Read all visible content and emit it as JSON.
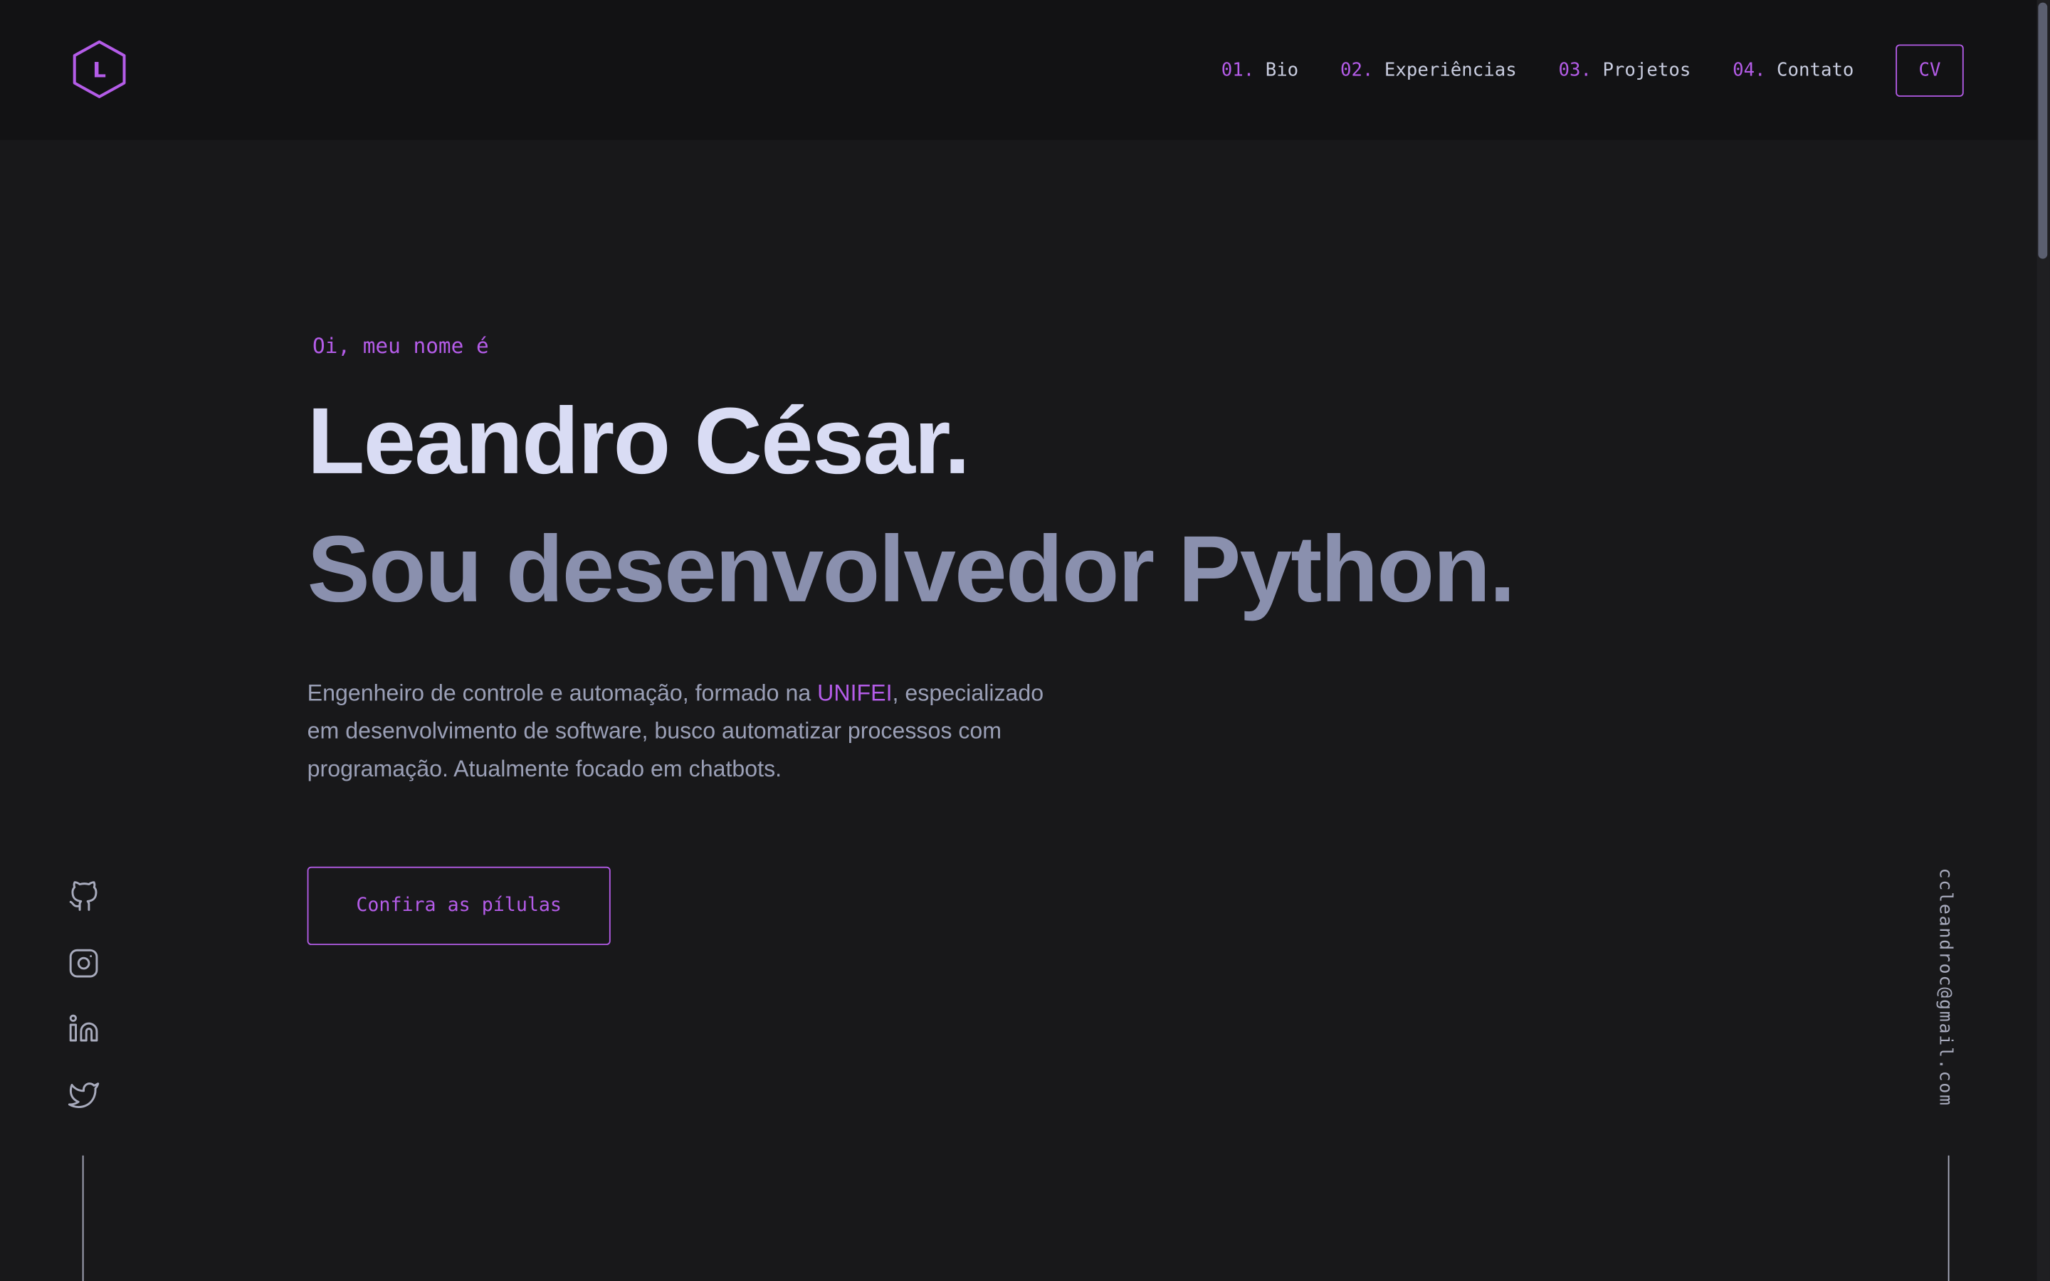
{
  "brand": {
    "logo_letter": "L",
    "accent_color": "#b45ce8"
  },
  "nav": {
    "items": [
      {
        "num": "01.",
        "label": "Bio"
      },
      {
        "num": "02.",
        "label": "Experiências"
      },
      {
        "num": "03.",
        "label": "Projetos"
      },
      {
        "num": "04.",
        "label": "Contato"
      }
    ],
    "cv_label": "CV"
  },
  "hero": {
    "greeting": "Oi, meu nome é",
    "name": "Leandro César.",
    "role": "Sou desenvolvedor Python.",
    "description_before": "Engenheiro de controle e automação, formado na ",
    "description_highlight": "UNIFEI",
    "description_after": ", especializado em desenvolvimento de software, busco automatizar processos com programação. Atualmente focado em chatbots.",
    "cta_label": "Confira as pílulas"
  },
  "social": {
    "icons": [
      "github-icon",
      "instagram-icon",
      "linkedin-icon",
      "twitter-icon"
    ]
  },
  "contact": {
    "email": "ccleandroc@gmail.com"
  }
}
